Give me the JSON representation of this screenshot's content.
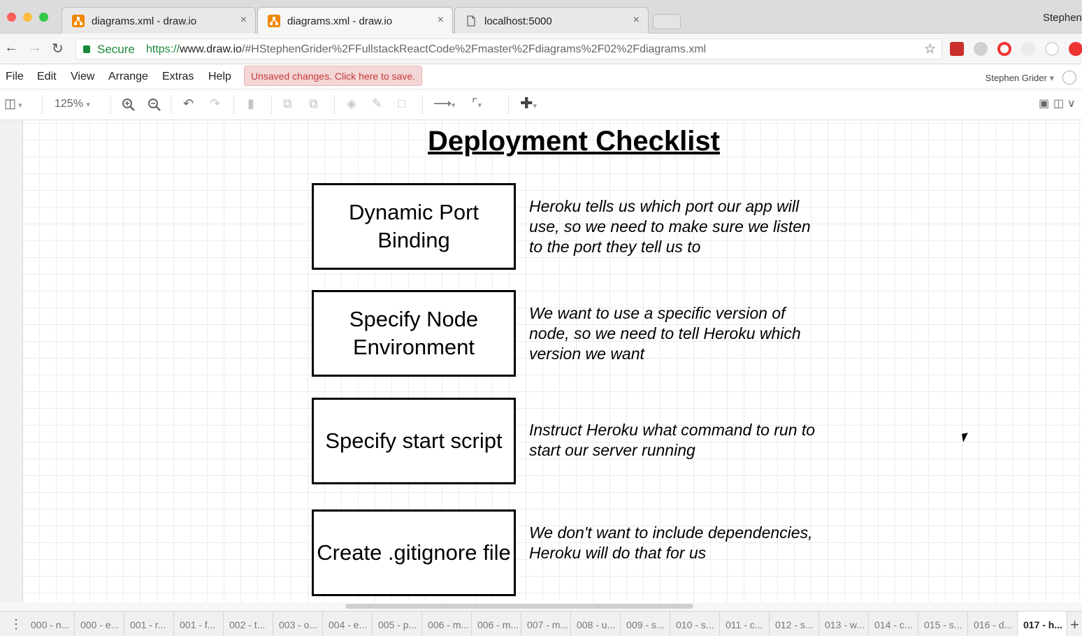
{
  "browser": {
    "tabs": [
      {
        "label": "diagrams.xml - draw.io",
        "close": "×"
      },
      {
        "label": "diagrams.xml - draw.io",
        "close": "×"
      },
      {
        "label": "localhost:5000",
        "close": "×"
      }
    ],
    "profile_name": "Stephen",
    "secure_label": "Secure",
    "url_protocol": "https://",
    "url_host": "www.draw.io",
    "url_path": "/#HStephenGrider%2FFullstackReactCode%2Fmaster%2Fdiagrams%2F02%2Fdiagrams.xml"
  },
  "menu": {
    "items": [
      "File",
      "Edit",
      "View",
      "Arrange",
      "Extras",
      "Help"
    ],
    "unsaved_notice": "Unsaved changes. Click here to save.",
    "user": "Stephen Grider"
  },
  "toolbar": {
    "zoom": "125%"
  },
  "diagram": {
    "title": "Deployment Checklist",
    "steps": [
      {
        "box": "Dynamic Port Binding",
        "desc": "Heroku tells us which port our app will use, so we need to make sure we listen to the port they tell us to"
      },
      {
        "box": "Specify Node Environment",
        "desc": "We want to use a specific version of node, so we need to tell Heroku which version we want"
      },
      {
        "box": "Specify start script",
        "desc": "Instruct Heroku what command to run to start our server running"
      },
      {
        "box": "Create .gitignore file",
        "desc": "We don't want to include dependencies, Heroku will do that for us"
      }
    ]
  },
  "pages": [
    "000 - n...",
    "000 - e...",
    "001 - r...",
    "001 - f...",
    "002 - t...",
    "003 - o...",
    "004 - e...",
    "005 - p...",
    "006 - m...",
    "006 - m...",
    "007 - m...",
    "008 - u...",
    "009 - s...",
    "010 - s...",
    "011 - c...",
    "012 - s...",
    "013 - w...",
    "014 - c...",
    "015 - s...",
    "016 - d...",
    "017 - h..."
  ],
  "active_page_index": 20,
  "colors": {
    "secure_green": "#1a8a3a",
    "unsaved_bg": "#f5d6d6",
    "unsaved_text": "#c53b3b",
    "drawio_orange": "#f08705"
  }
}
